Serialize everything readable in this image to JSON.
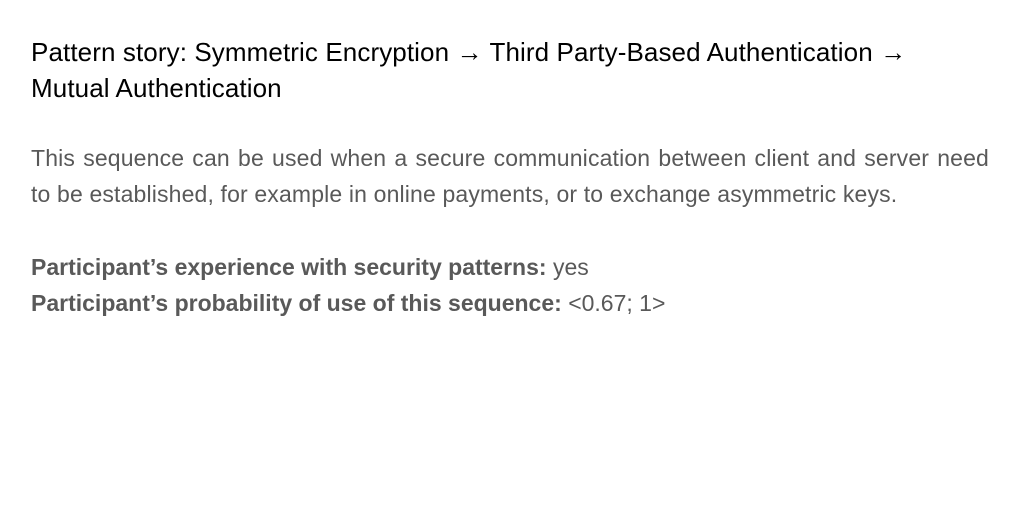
{
  "story": {
    "title": "Pattern story: Symmetric Encryption → Third Party-Based Authentication → Mutual Authentication",
    "description": "This sequence can be used when a secure communication between client and server need to be established, for example in online payments, or to exchange asymmetric keys."
  },
  "participant": {
    "experience_label": "Participant’s experience with security patterns:",
    "experience_value": "yes",
    "probability_label": "Participant’s probability of use of this sequence:",
    "probability_value": "<0.67; 1>"
  }
}
